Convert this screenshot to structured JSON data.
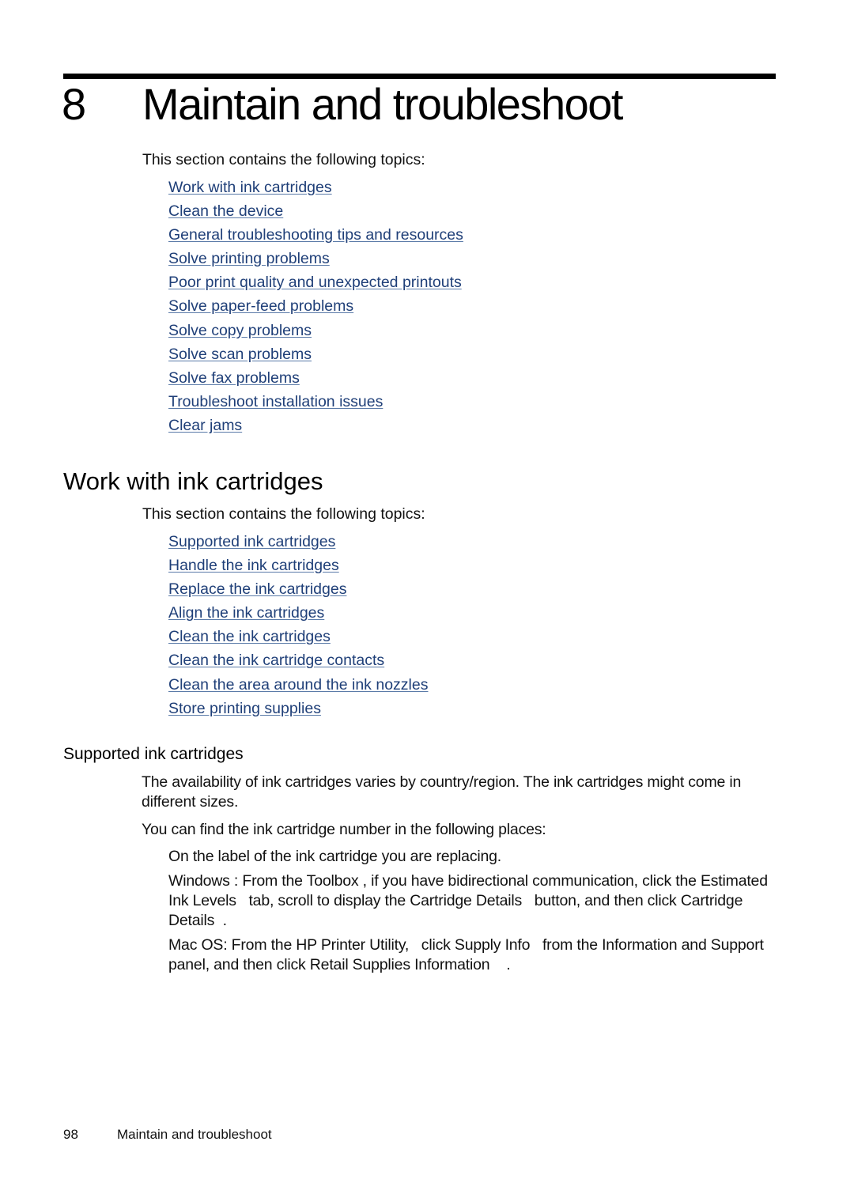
{
  "chapter": {
    "number": "8",
    "title": "Maintain and troubleshoot"
  },
  "chapter_intro": "This section contains the following topics:",
  "chapter_links": [
    "Work with ink cartridges",
    "Clean the device",
    "General troubleshooting tips and resources",
    "Solve printing problems",
    "Poor print quality and unexpected printouts",
    "Solve paper-feed problems",
    "Solve copy problems",
    "Solve scan problems",
    "Solve fax problems",
    "Troubleshoot installation issues",
    "Clear jams"
  ],
  "section": {
    "title": "Work with ink cartridges",
    "intro": "This section contains the following topics:",
    "links": [
      "Supported ink cartridges",
      "Handle the ink cartridges",
      "Replace the ink cartridges",
      "Align the ink cartridges",
      "Clean the ink cartridges",
      "Clean the ink cartridge contacts",
      "Clean the area around the ink nozzles",
      "Store printing supplies"
    ]
  },
  "subsection": {
    "title": "Supported ink cartridges",
    "paragraph1": "The availability of ink cartridges varies by country/region. The ink cartridges might come in different sizes.",
    "paragraph2": "You can find the ink cartridge number in the following places:",
    "bullets": [
      "On the label of the ink cartridge you are replacing.",
      "Windows : From the Toolbox , if you have bidirectional communication, click the Estimated Ink Levels   tab, scroll to display the Cartridge Details   button, and then click Cartridge Details  .",
      "Mac OS: From the HP Printer Utility,   click Supply Info   from the Information and Support  panel, and then click Retail Supplies Information    ."
    ]
  },
  "footer": {
    "page_number": "98",
    "running_title": "Maintain and troubleshoot"
  }
}
